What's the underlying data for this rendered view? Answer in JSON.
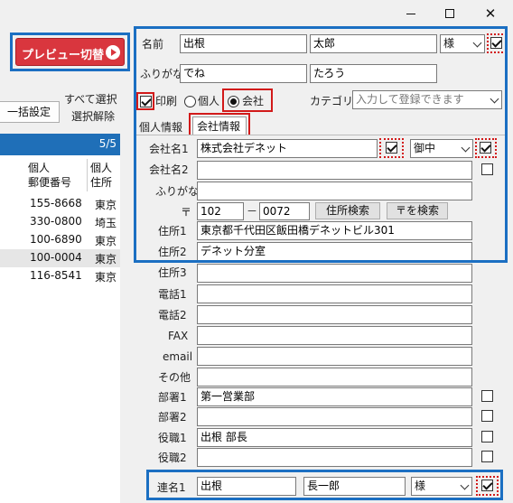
{
  "window": {
    "minimize": "—",
    "maximize": "☐",
    "close": "✕"
  },
  "preview_button": {
    "label": "プレビュー切替"
  },
  "left": {
    "bulk_button": "一括設定",
    "select_all": "すべて選択",
    "deselect_all": "選択解除",
    "count": "5/5",
    "columns": [
      "個人\n郵便番号",
      "個人\n住所"
    ],
    "rows": [
      {
        "zip": "155-8668",
        "addr": "東京"
      },
      {
        "zip": "330-0800",
        "addr": "埼玉"
      },
      {
        "zip": "100-6890",
        "addr": "東京"
      },
      {
        "zip": "100-0004",
        "addr": "東京"
      },
      {
        "zip": "116-8541",
        "addr": "東京"
      }
    ]
  },
  "form": {
    "name_label": "名前",
    "last_name": "出根",
    "first_name": "太郎",
    "honorific": "様",
    "furigana_label": "ふりがな",
    "furigana_last": "でね",
    "furigana_first": "たろう",
    "print_label": "印刷",
    "individual_label": "個人",
    "company_label": "会社",
    "category_label": "カテゴリ",
    "category_placeholder": "入力して登録できます",
    "tab_personal": "個人情報",
    "tab_company": "会社情報",
    "company1_label": "会社名1",
    "company1_value": "株式会社デネット",
    "company_honorific": "御中",
    "company2_label": "会社名2",
    "company_furigana_label": "ふりがな",
    "postal_mark": "〒",
    "zip1": "102",
    "zip_dash": "－",
    "zip2": "0072",
    "address_search": "住所検索",
    "zip_search": "〒を検索",
    "address1_label": "住所1",
    "address1_value": "東京都千代田区飯田橋デネットビル301",
    "address2_label": "住所2",
    "address2_value": "デネット分室",
    "address3_label": "住所3",
    "phone1_label": "電話1",
    "phone2_label": "電話2",
    "fax_label": "FAX",
    "email_label": "email",
    "other_label": "その他",
    "dept1_label": "部署1",
    "dept1_value": "第一営業部",
    "dept2_label": "部署2",
    "title1_label": "役職1",
    "title1_value": "出根 部長",
    "title2_label": "役職2",
    "joint_label": "連名1",
    "joint_last": "出根",
    "joint_first": "長一郎",
    "joint_honorific": "様"
  }
}
